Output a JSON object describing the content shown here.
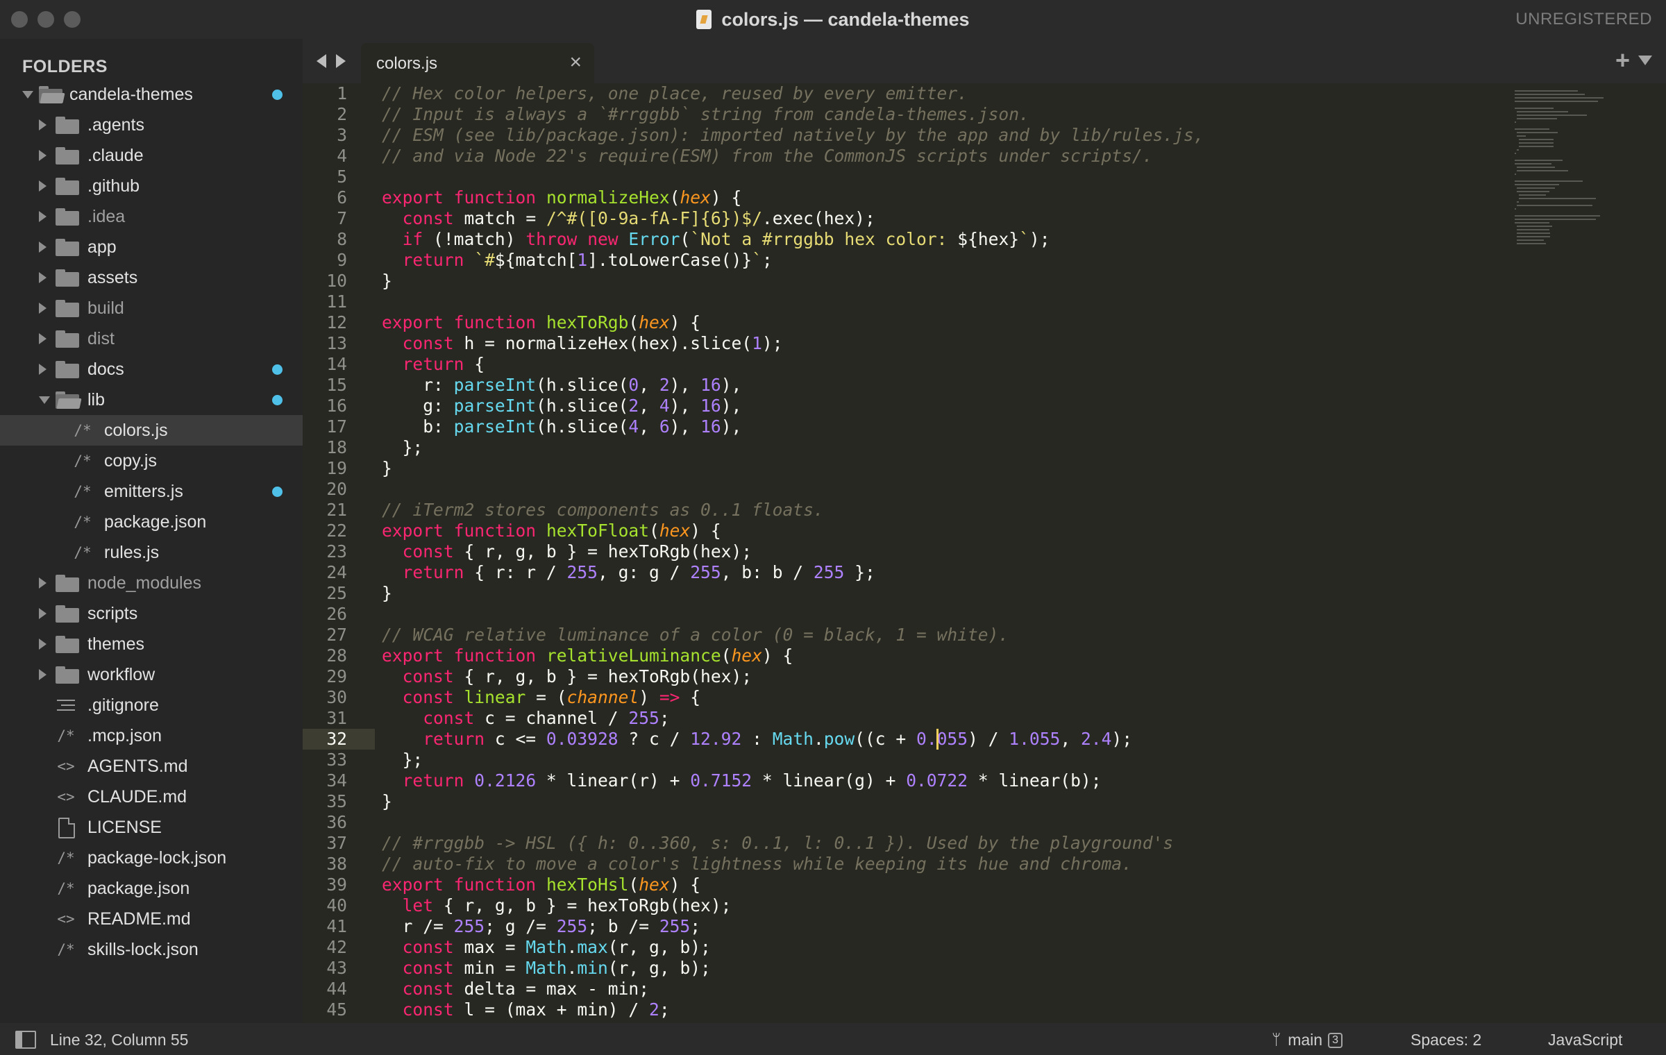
{
  "window": {
    "title": "colors.js — candela-themes",
    "registration": "UNREGISTERED"
  },
  "sidebar": {
    "heading": "FOLDERS",
    "items": [
      {
        "label": "candela-themes",
        "kind": "folder-open",
        "depth": 0,
        "dot": true
      },
      {
        "label": ".agents",
        "kind": "folder",
        "depth": 1
      },
      {
        "label": ".claude",
        "kind": "folder",
        "depth": 1
      },
      {
        "label": ".github",
        "kind": "folder",
        "depth": 1
      },
      {
        "label": ".idea",
        "kind": "folder",
        "depth": 1,
        "dim": true
      },
      {
        "label": "app",
        "kind": "folder",
        "depth": 1
      },
      {
        "label": "assets",
        "kind": "folder",
        "depth": 1
      },
      {
        "label": "build",
        "kind": "folder",
        "depth": 1,
        "dim": true
      },
      {
        "label": "dist",
        "kind": "folder",
        "depth": 1,
        "dim": true
      },
      {
        "label": "docs",
        "kind": "folder",
        "depth": 1,
        "dot": true
      },
      {
        "label": "lib",
        "kind": "folder-open",
        "depth": 1,
        "dot": true
      },
      {
        "label": "colors.js",
        "kind": "file",
        "glyph": "/*",
        "depth": 2,
        "selected": true
      },
      {
        "label": "copy.js",
        "kind": "file",
        "glyph": "/*",
        "depth": 2
      },
      {
        "label": "emitters.js",
        "kind": "file",
        "glyph": "/*",
        "depth": 2,
        "dot": true
      },
      {
        "label": "package.json",
        "kind": "file",
        "glyph": "/*",
        "depth": 2
      },
      {
        "label": "rules.js",
        "kind": "file",
        "glyph": "/*",
        "depth": 2
      },
      {
        "label": "node_modules",
        "kind": "folder",
        "depth": 1,
        "dim": true
      },
      {
        "label": "scripts",
        "kind": "folder",
        "depth": 1
      },
      {
        "label": "themes",
        "kind": "folder",
        "depth": 1
      },
      {
        "label": "workflow",
        "kind": "folder",
        "depth": 1
      },
      {
        "label": ".gitignore",
        "kind": "lines",
        "depth": 1
      },
      {
        "label": ".mcp.json",
        "kind": "file",
        "glyph": "/*",
        "depth": 1
      },
      {
        "label": "AGENTS.md",
        "kind": "file",
        "glyph": "<>",
        "depth": 1
      },
      {
        "label": "CLAUDE.md",
        "kind": "file",
        "glyph": "<>",
        "depth": 1
      },
      {
        "label": "LICENSE",
        "kind": "doc",
        "depth": 1
      },
      {
        "label": "package-lock.json",
        "kind": "file",
        "glyph": "/*",
        "depth": 1
      },
      {
        "label": "package.json",
        "kind": "file",
        "glyph": "/*",
        "depth": 1
      },
      {
        "label": "README.md",
        "kind": "file",
        "glyph": "<>",
        "depth": 1
      },
      {
        "label": "skills-lock.json",
        "kind": "file",
        "glyph": "/*",
        "depth": 1
      }
    ]
  },
  "tabs": [
    {
      "label": "colors.js",
      "close": "×",
      "active": true
    }
  ],
  "tab_actions": {
    "new_tab": "+"
  },
  "editor": {
    "current_line": 32,
    "caret_column": 55,
    "lines": [
      [
        [
          "c",
          "// Hex color helpers, one place, reused by every emitter."
        ]
      ],
      [
        [
          "c",
          "// Input is always a `#rrggbb` string from candela-themes.json."
        ]
      ],
      [
        [
          "c",
          "// ESM (see lib/package.json): imported natively by the app and by lib/rules.js,"
        ]
      ],
      [
        [
          "c",
          "// and via Node 22's require(ESM) from the CommonJS scripts under scripts/."
        ]
      ],
      [],
      [
        [
          "k",
          "export"
        ],
        [
          "t",
          " "
        ],
        [
          "k",
          "function"
        ],
        [
          "t",
          " "
        ],
        [
          "f",
          "normalizeHex"
        ],
        [
          "t",
          "("
        ],
        [
          "p",
          "hex"
        ],
        [
          "t",
          ") {"
        ]
      ],
      [
        [
          "t",
          "  "
        ],
        [
          "k",
          "const"
        ],
        [
          "t",
          " match = "
        ],
        [
          "s",
          "/^#([0-9a-fA-F]{6})$/"
        ],
        [
          "t",
          ".exec(hex);"
        ]
      ],
      [
        [
          "t",
          "  "
        ],
        [
          "k",
          "if"
        ],
        [
          "t",
          " (!match) "
        ],
        [
          "k",
          "throw"
        ],
        [
          "t",
          " "
        ],
        [
          "k",
          "new"
        ],
        [
          "t",
          " "
        ],
        [
          "b",
          "Error"
        ],
        [
          "t",
          "("
        ],
        [
          "s",
          "`Not a #rrggbb hex color: "
        ],
        [
          "t",
          "${hex}"
        ],
        [
          "s",
          "`"
        ],
        [
          "t",
          ");"
        ]
      ],
      [
        [
          "t",
          "  "
        ],
        [
          "k",
          "return"
        ],
        [
          "t",
          " "
        ],
        [
          "s",
          "`#"
        ],
        [
          "t",
          "${match["
        ],
        [
          "n",
          "1"
        ],
        [
          "t",
          "].toLowerCase()}"
        ],
        [
          "s",
          "`"
        ],
        [
          "t",
          ";"
        ]
      ],
      [
        [
          "t",
          "}"
        ]
      ],
      [],
      [
        [
          "k",
          "export"
        ],
        [
          "t",
          " "
        ],
        [
          "k",
          "function"
        ],
        [
          "t",
          " "
        ],
        [
          "f",
          "hexToRgb"
        ],
        [
          "t",
          "("
        ],
        [
          "p",
          "hex"
        ],
        [
          "t",
          ") {"
        ]
      ],
      [
        [
          "t",
          "  "
        ],
        [
          "k",
          "const"
        ],
        [
          "t",
          " h = normalizeHex(hex).slice("
        ],
        [
          "n",
          "1"
        ],
        [
          "t",
          ");"
        ]
      ],
      [
        [
          "t",
          "  "
        ],
        [
          "k",
          "return"
        ],
        [
          "t",
          " {"
        ]
      ],
      [
        [
          "t",
          "    r: "
        ],
        [
          "b",
          "parseInt"
        ],
        [
          "t",
          "(h.slice("
        ],
        [
          "n",
          "0"
        ],
        [
          "t",
          ", "
        ],
        [
          "n",
          "2"
        ],
        [
          "t",
          "), "
        ],
        [
          "n",
          "16"
        ],
        [
          "t",
          "),"
        ]
      ],
      [
        [
          "t",
          "    g: "
        ],
        [
          "b",
          "parseInt"
        ],
        [
          "t",
          "(h.slice("
        ],
        [
          "n",
          "2"
        ],
        [
          "t",
          ", "
        ],
        [
          "n",
          "4"
        ],
        [
          "t",
          "), "
        ],
        [
          "n",
          "16"
        ],
        [
          "t",
          "),"
        ]
      ],
      [
        [
          "t",
          "    b: "
        ],
        [
          "b",
          "parseInt"
        ],
        [
          "t",
          "(h.slice("
        ],
        [
          "n",
          "4"
        ],
        [
          "t",
          ", "
        ],
        [
          "n",
          "6"
        ],
        [
          "t",
          "), "
        ],
        [
          "n",
          "16"
        ],
        [
          "t",
          "),"
        ]
      ],
      [
        [
          "t",
          "  };"
        ]
      ],
      [
        [
          "t",
          "}"
        ]
      ],
      [],
      [
        [
          "c",
          "// iTerm2 stores components as 0..1 floats."
        ]
      ],
      [
        [
          "k",
          "export"
        ],
        [
          "t",
          " "
        ],
        [
          "k",
          "function"
        ],
        [
          "t",
          " "
        ],
        [
          "f",
          "hexToFloat"
        ],
        [
          "t",
          "("
        ],
        [
          "p",
          "hex"
        ],
        [
          "t",
          ") {"
        ]
      ],
      [
        [
          "t",
          "  "
        ],
        [
          "k",
          "const"
        ],
        [
          "t",
          " { r, g, b } = hexToRgb(hex);"
        ]
      ],
      [
        [
          "t",
          "  "
        ],
        [
          "k",
          "return"
        ],
        [
          "t",
          " { r: r / "
        ],
        [
          "n",
          "255"
        ],
        [
          "t",
          ", g: g / "
        ],
        [
          "n",
          "255"
        ],
        [
          "t",
          ", b: b / "
        ],
        [
          "n",
          "255"
        ],
        [
          "t",
          " };"
        ]
      ],
      [
        [
          "t",
          "}"
        ]
      ],
      [],
      [
        [
          "c",
          "// WCAG relative luminance of a color (0 = black, 1 = white)."
        ]
      ],
      [
        [
          "k",
          "export"
        ],
        [
          "t",
          " "
        ],
        [
          "k",
          "function"
        ],
        [
          "t",
          " "
        ],
        [
          "f",
          "relativeLuminance"
        ],
        [
          "t",
          "("
        ],
        [
          "p",
          "hex"
        ],
        [
          "t",
          ") {"
        ]
      ],
      [
        [
          "t",
          "  "
        ],
        [
          "k",
          "const"
        ],
        [
          "t",
          " { r, g, b } = hexToRgb(hex);"
        ]
      ],
      [
        [
          "t",
          "  "
        ],
        [
          "k",
          "const"
        ],
        [
          "t",
          " "
        ],
        [
          "f",
          "linear"
        ],
        [
          "t",
          " = ("
        ],
        [
          "p",
          "channel"
        ],
        [
          "t",
          ") "
        ],
        [
          "k",
          "=>"
        ],
        [
          "t",
          " {"
        ]
      ],
      [
        [
          "t",
          "    "
        ],
        [
          "k",
          "const"
        ],
        [
          "t",
          " c = channel / "
        ],
        [
          "n",
          "255"
        ],
        [
          "t",
          ";"
        ]
      ],
      [
        [
          "t",
          "    "
        ],
        [
          "k",
          "return"
        ],
        [
          "t",
          " c <= "
        ],
        [
          "n",
          "0.03928"
        ],
        [
          "t",
          " ? c / "
        ],
        [
          "n",
          "12.92"
        ],
        [
          "t",
          " : "
        ],
        [
          "b",
          "Math"
        ],
        [
          "t",
          "."
        ],
        [
          "b",
          "pow"
        ],
        [
          "t",
          "((c + "
        ],
        [
          "n",
          "0.055"
        ],
        [
          "t",
          ") / "
        ],
        [
          "n",
          "1.055"
        ],
        [
          "t",
          ", "
        ],
        [
          "n",
          "2.4"
        ],
        [
          "t",
          ");"
        ]
      ],
      [
        [
          "t",
          "  };"
        ]
      ],
      [
        [
          "t",
          "  "
        ],
        [
          "k",
          "return"
        ],
        [
          "t",
          " "
        ],
        [
          "n",
          "0.2126"
        ],
        [
          "t",
          " * linear(r) + "
        ],
        [
          "n",
          "0.7152"
        ],
        [
          "t",
          " * linear(g) + "
        ],
        [
          "n",
          "0.0722"
        ],
        [
          "t",
          " * linear(b);"
        ]
      ],
      [
        [
          "t",
          "}"
        ]
      ],
      [],
      [
        [
          "c",
          "// #rrggbb -> HSL ({ h: 0..360, s: 0..1, l: 0..1 }). Used by the playground's"
        ]
      ],
      [
        [
          "c",
          "// auto-fix to move a color's lightness while keeping its hue and chroma."
        ]
      ],
      [
        [
          "k",
          "export"
        ],
        [
          "t",
          " "
        ],
        [
          "k",
          "function"
        ],
        [
          "t",
          " "
        ],
        [
          "f",
          "hexToHsl"
        ],
        [
          "t",
          "("
        ],
        [
          "p",
          "hex"
        ],
        [
          "t",
          ") {"
        ]
      ],
      [
        [
          "t",
          "  "
        ],
        [
          "k",
          "let"
        ],
        [
          "t",
          " { r, g, b } = hexToRgb(hex);"
        ]
      ],
      [
        [
          "t",
          "  r /= "
        ],
        [
          "n",
          "255"
        ],
        [
          "t",
          "; g /= "
        ],
        [
          "n",
          "255"
        ],
        [
          "t",
          "; b /= "
        ],
        [
          "n",
          "255"
        ],
        [
          "t",
          ";"
        ]
      ],
      [
        [
          "t",
          "  "
        ],
        [
          "k",
          "const"
        ],
        [
          "t",
          " max = "
        ],
        [
          "b",
          "Math"
        ],
        [
          "t",
          "."
        ],
        [
          "b",
          "max"
        ],
        [
          "t",
          "(r, g, b);"
        ]
      ],
      [
        [
          "t",
          "  "
        ],
        [
          "k",
          "const"
        ],
        [
          "t",
          " min = "
        ],
        [
          "b",
          "Math"
        ],
        [
          "t",
          "."
        ],
        [
          "b",
          "min"
        ],
        [
          "t",
          "(r, g, b);"
        ]
      ],
      [
        [
          "t",
          "  "
        ],
        [
          "k",
          "const"
        ],
        [
          "t",
          " delta = max - min;"
        ]
      ],
      [
        [
          "t",
          "  "
        ],
        [
          "k",
          "const"
        ],
        [
          "t",
          " l = (max + min) / "
        ],
        [
          "n",
          "2"
        ],
        [
          "t",
          ";"
        ]
      ]
    ]
  },
  "status": {
    "position": "Line 32, Column 55",
    "branch": "main",
    "branch_count": "3",
    "indent": "Spaces: 2",
    "language": "JavaScript"
  },
  "colors": {
    "keyword": "#f92672",
    "string": "#e6db74",
    "number": "#ae81ff",
    "comment": "#75715e",
    "function": "#a6e22e",
    "builtin": "#66d9ef",
    "param": "#fd971f",
    "modified_dot": "#4fc1e9",
    "caret": "#f8d25c"
  }
}
